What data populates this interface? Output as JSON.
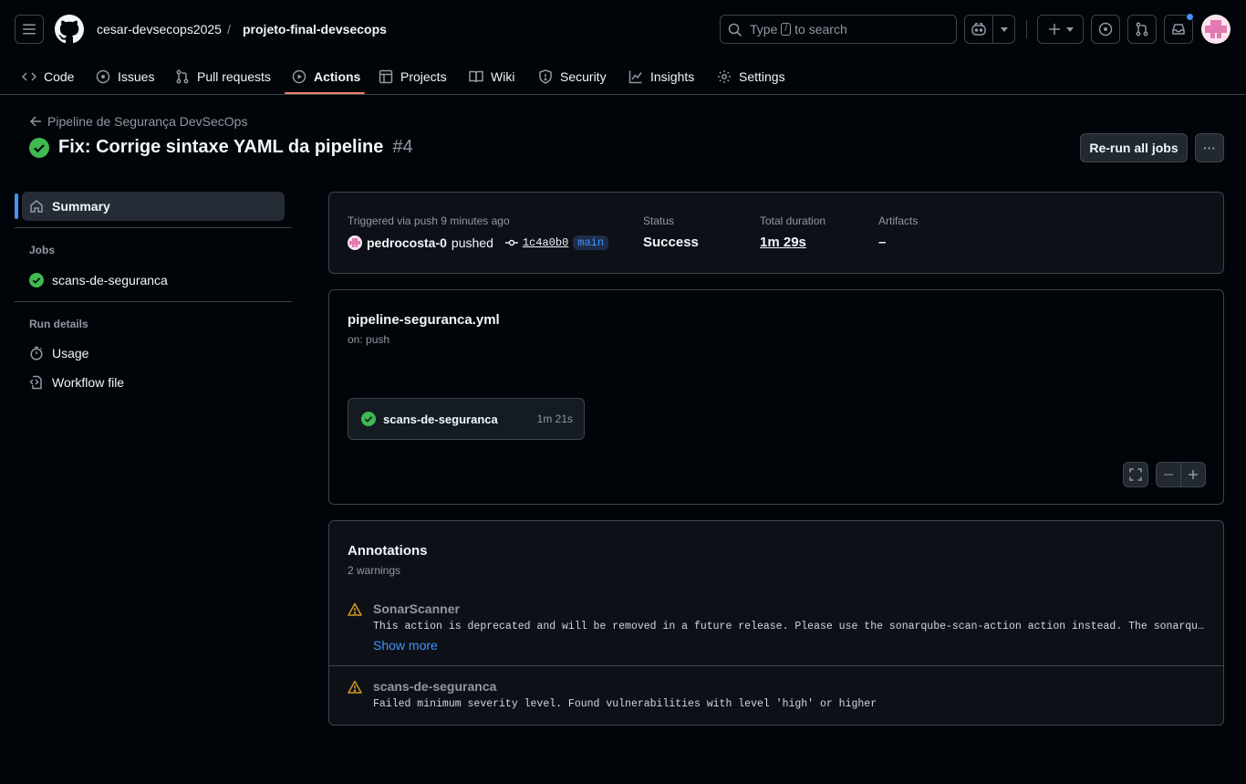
{
  "header": {
    "owner": "cesar-devsecops2025",
    "separator": "/",
    "repo": "projeto-final-devsecops",
    "search_prefix": "Type",
    "search_key": "/",
    "search_suffix": "to search"
  },
  "tabs": [
    {
      "label": "Code"
    },
    {
      "label": "Issues"
    },
    {
      "label": "Pull requests"
    },
    {
      "label": "Actions"
    },
    {
      "label": "Projects"
    },
    {
      "label": "Wiki"
    },
    {
      "label": "Security"
    },
    {
      "label": "Insights"
    },
    {
      "label": "Settings"
    }
  ],
  "run": {
    "back_label": "Pipeline de Segurança DevSecOps",
    "title": "Fix: Corrige sintaxe YAML da pipeline",
    "number": "#4",
    "rerun_label": "Re-run all jobs",
    "more_label": "···"
  },
  "sidebar": {
    "summary": "Summary",
    "jobs_heading": "Jobs",
    "job": "scans-de-seguranca",
    "run_details_heading": "Run details",
    "usage": "Usage",
    "workflow_file": "Workflow file"
  },
  "summary": {
    "triggered": "Triggered via push 9 minutes ago",
    "actor": "pedrocosta-0",
    "action": "pushed",
    "commit": "1c4a0b0",
    "branch": "main",
    "status_label": "Status",
    "status_value": "Success",
    "duration_label": "Total duration",
    "duration_value": "1m 29s",
    "artifacts_label": "Artifacts",
    "artifacts_value": "–"
  },
  "workflow": {
    "file": "pipeline-seguranca.yml",
    "trigger": "on: push",
    "job_name": "scans-de-seguranca",
    "job_duration": "1m 21s"
  },
  "annotations": {
    "title": "Annotations",
    "count": "2 warnings",
    "items": [
      {
        "title": "SonarScanner",
        "message": "This action is deprecated and will be removed in a future release. Please use the sonarqube-scan-action action instead. The sonarqube-scan-action is a drop-in replacement.",
        "more": "Show more"
      },
      {
        "title": "scans-de-seguranca",
        "message": "Failed minimum severity level. Found vulnerabilities with level 'high' or higher"
      }
    ]
  },
  "colors": {
    "success": "#3fb950",
    "warning": "#d29922",
    "accent": "#4493f8",
    "tab_underline": "#f78166"
  }
}
